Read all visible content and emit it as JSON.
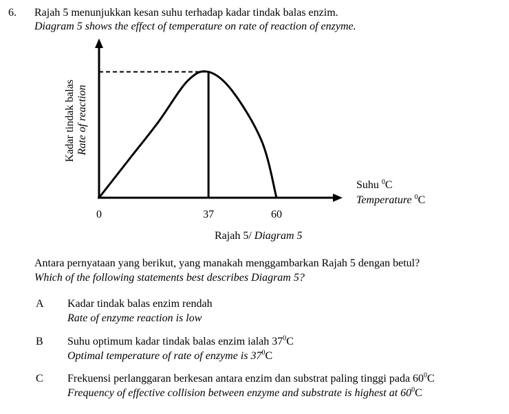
{
  "question": {
    "number": "6.",
    "text_ms": "Rajah 5 menunjukkan kesan suhu terhadap kadar tindak balas enzim.",
    "text_en": "Diagram 5 shows the effect of temperature on rate of reaction of enzyme."
  },
  "chart_data": {
    "type": "line",
    "x": [
      0,
      10,
      20,
      30,
      37,
      45,
      55,
      60
    ],
    "y": [
      0,
      30,
      60,
      93,
      100,
      85,
      45,
      0
    ],
    "xticks": [
      "0",
      "37",
      "60"
    ],
    "xlim": [
      0,
      80
    ],
    "ylim": [
      0,
      120
    ],
    "ylabel_ms": "Kadar tindak balas",
    "ylabel_en": "Rate of reaction",
    "xlabel_ms": "Suhu ",
    "xlabel_en": "Temperature ",
    "unit_sup": "0",
    "unit": "C",
    "optimum_x": 37,
    "grid": false
  },
  "caption": {
    "ms": "Rajah 5/ ",
    "en": "Diagram 5"
  },
  "prompt": {
    "ms": "Antara pernyataan yang berikut, yang manakah menggambarkan Rajah 5 dengan betul?",
    "en": "Which of the following statements best describes Diagram 5?"
  },
  "options": [
    {
      "letter": "A",
      "ms": "Kadar tindak balas enzim rendah",
      "en": "Rate of enzyme reaction is low"
    },
    {
      "letter": "B",
      "ms": "Suhu optimum kadar tindak balas enzim ialah 37",
      "ms_sup": "0",
      "ms_unit": "C",
      "en": "Optimal temperature of rate of enzyme is 37",
      "en_sup": "0",
      "en_unit": "C"
    },
    {
      "letter": "C",
      "ms": "Frekuensi perlanggaran berkesan antara enzim dan substrat paling tinggi pada 60",
      "ms_sup": "0",
      "ms_unit": "C",
      "en": "Frequency of effective collision between enzyme and substrate is highest at 60",
      "en_sup": "0",
      "en_unit": "C"
    }
  ]
}
